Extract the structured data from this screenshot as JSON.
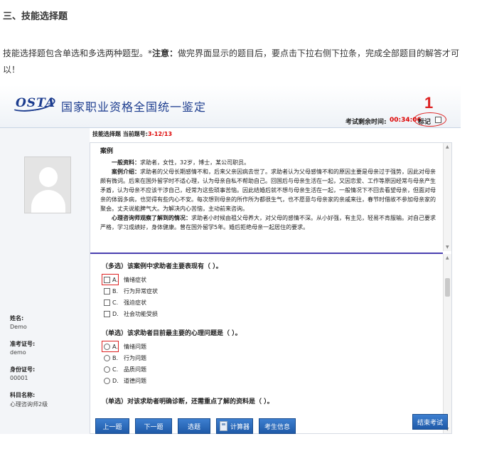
{
  "article": {
    "heading": "三、技能选择题",
    "paragraph_pre": "技能选择题包含单选和多选两种题型。*",
    "paragraph_bold": "注意：",
    "paragraph_post": "做完界面显示的题目后，要点击下拉右侧下拉条，完成全部题目的解答才可以！"
  },
  "header": {
    "logo": "OSTA",
    "title": "国家职业资格全国统一鉴定",
    "time_label": "考试剩余时间:",
    "time_value": "00:34:06",
    "mark_label": "标记",
    "annotation": "1"
  },
  "sidebar": {
    "name_label": "姓名:",
    "name_value": "Demo",
    "ticket_label": "准考证号:",
    "ticket_value": "demo",
    "id_label": "身份证号:",
    "id_value": "00001",
    "subject_label": "科目名称:",
    "subject_value": "心理咨询师2级"
  },
  "question_bar": {
    "type_label": "技能选择题  当前题号:",
    "current": "3-12/13"
  },
  "case": {
    "title": "案例",
    "basic_label": "一般资料：",
    "basic_text": "求助者，女性，32岁，博士，某公司职员。",
    "intro_label": "案例介绍：",
    "intro_text": "求助者的父母长期感情不和，后来父亲因病去世了。求助者认为父母感情不和的原因主要是母亲过于强势，因此对母亲颇有微词。后来在国外留学时不适心理，认为母亲自私不帮助自己。回国后与母亲生活在一起，又因恋爱、工作等原因经常与母亲产生矛盾，认为母亲不应该干涉自己，经常为这些琐事苦恼。因此结婚后就不想与母亲生活在一起，一般情况下不回去看望母亲，但面对母亲的体弱多病，也觉得有些内心不安。每次想到母亲的所作所为都很生气，也不愿意与母亲家的亲戚来往，春节时借故不参加母亲家的聚会。丈夫说能脾气大。为解决内心苦恼，主动前来咨询。",
    "obs_label": "心理咨询师观察了解到的情况：",
    "obs_text": "求助者小时候由祖父母养大，对父母的感情不深。从小好强，有主见，轻易不肯服输。对自己要求严格，学习成绩好，身体健康。曾在国外留学5年。婚后拒绝母亲一起居住的要求。"
  },
  "questions": [
    {
      "stem": "（多选）该案例中求助者主要表现有（     ）。",
      "kind": "checkbox",
      "options": [
        {
          "letter": "A.",
          "text": "情绪症状"
        },
        {
          "letter": "B.",
          "text": "行为异常症状"
        },
        {
          "letter": "C.",
          "text": "强迫症状"
        },
        {
          "letter": "D.",
          "text": "社会功能受损"
        }
      ]
    },
    {
      "stem": "（单选）该求助者目前最主要的心理问题是（     ）。",
      "kind": "radio",
      "options": [
        {
          "letter": "A.",
          "text": "情绪问题"
        },
        {
          "letter": "B.",
          "text": "行为问题"
        },
        {
          "letter": "C.",
          "text": "品质问题"
        },
        {
          "letter": "D.",
          "text": "道德问题"
        }
      ]
    },
    {
      "stem": "（单选）对该求助者明确诊断，还需重点了解的资料是（     ）。",
      "kind": "radio",
      "options": []
    }
  ],
  "buttons": {
    "prev": "上一题",
    "next": "下一题",
    "select": "选题",
    "calc": "计算器",
    "info": "考生信息",
    "end": "结束考试"
  },
  "colors": {
    "brand_blue": "#1d3d8f",
    "button_blue": "#2a6bbd",
    "alert_red": "#d22222",
    "divider": "#4a3fb0"
  }
}
